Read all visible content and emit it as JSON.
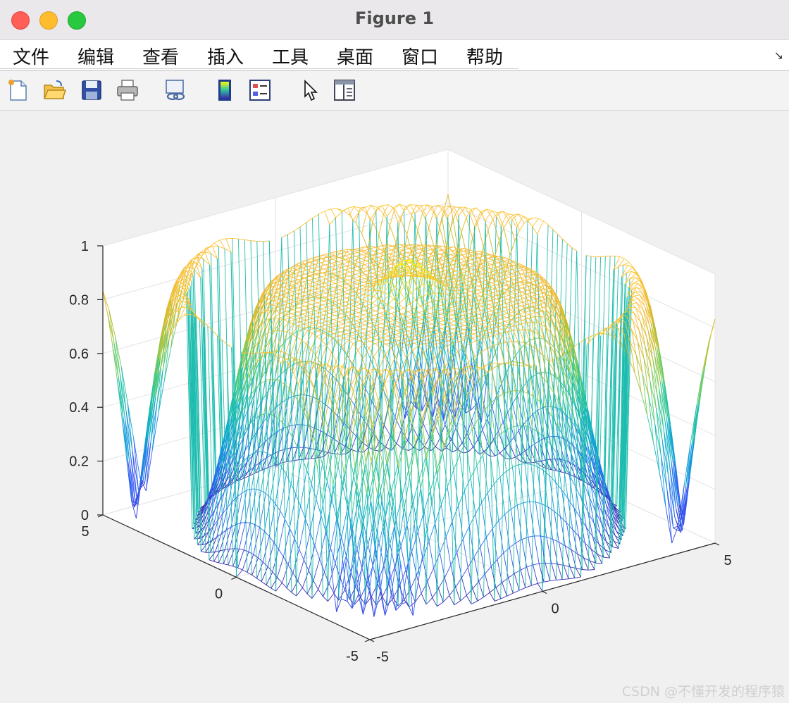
{
  "window": {
    "title": "Figure 1"
  },
  "menu": {
    "items": [
      "文件",
      "编辑",
      "查看",
      "插入",
      "工具",
      "桌面",
      "窗口",
      "帮助"
    ],
    "dock_glyph": "↘"
  },
  "toolbar": {
    "buttons": [
      {
        "name": "new-figure-icon"
      },
      {
        "name": "open-file-icon"
      },
      {
        "name": "save-icon"
      },
      {
        "name": "print-icon"
      },
      {
        "name": "link-plot-icon"
      },
      {
        "name": "colorbar-icon"
      },
      {
        "name": "legend-icon"
      },
      {
        "name": "edit-plot-cursor-icon"
      },
      {
        "name": "property-inspector-icon"
      }
    ]
  },
  "chart_data": {
    "type": "surface-mesh",
    "colormap": "parula",
    "z_ticks": [
      "0",
      "0.2",
      "0.4",
      "0.6",
      "0.8",
      "1"
    ],
    "x_ticks": [
      "-5",
      "0",
      "5"
    ],
    "y_ticks": [
      "-5",
      "0",
      "5"
    ],
    "xlim": [
      -5,
      5
    ],
    "ylim": [
      -5,
      5
    ],
    "zlim": [
      0,
      1
    ],
    "grid": true
  },
  "watermark": "CSDN @不懂开发的程序猿"
}
